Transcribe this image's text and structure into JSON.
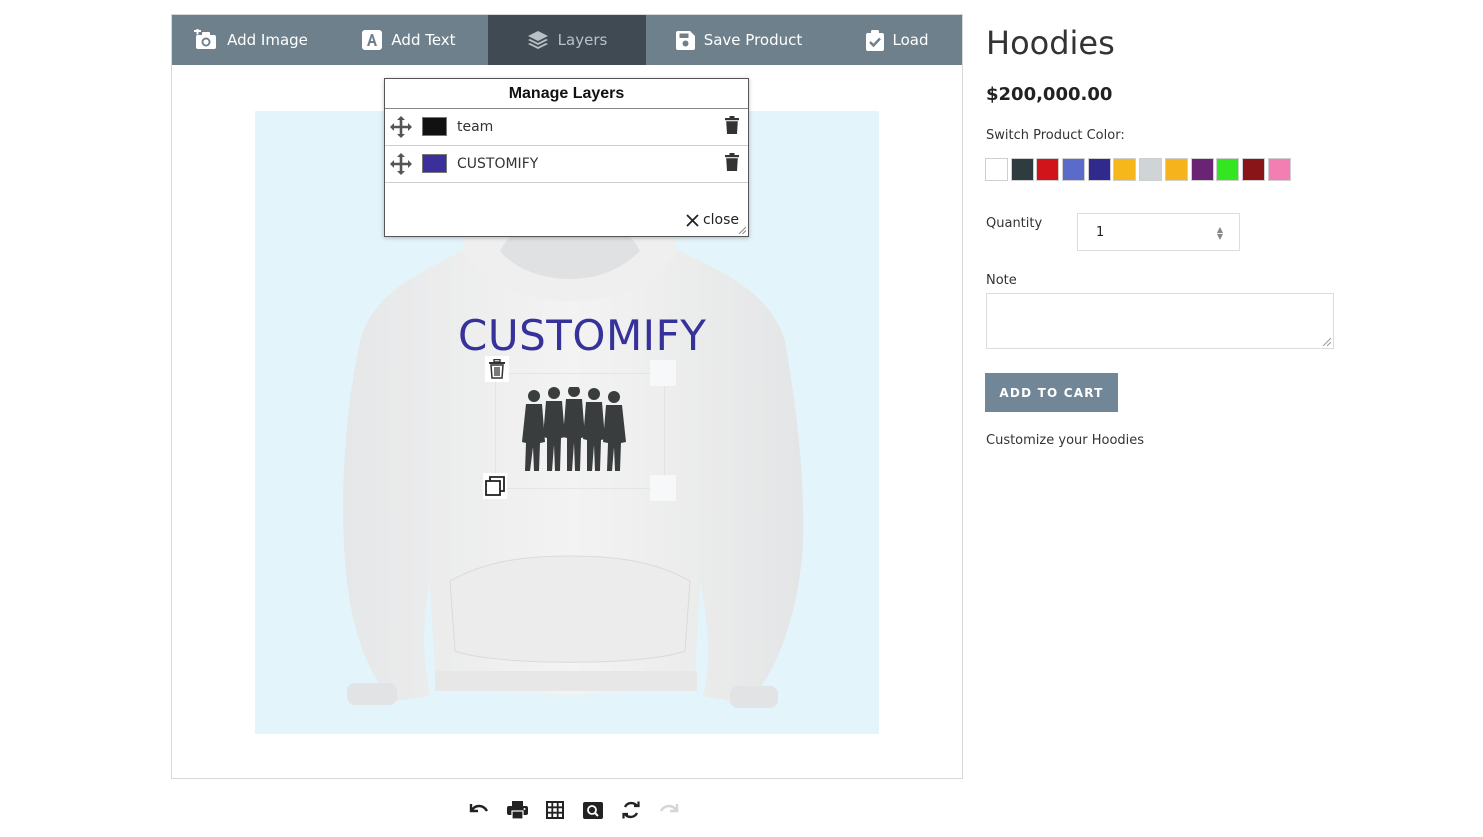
{
  "toolbar": {
    "add_image": "Add Image",
    "add_text": "Add Text",
    "layers": "Layers",
    "save_product": "Save Product",
    "load": "Load"
  },
  "canvas": {
    "design_text": "CUSTOMIFY"
  },
  "layers_modal": {
    "title": "Manage Layers",
    "layers": [
      {
        "name": "team",
        "color": "#111111"
      },
      {
        "name": "CUSTOMIFY",
        "color": "#3b2f9c"
      }
    ],
    "close_label": "close"
  },
  "bottom_tools": [
    "undo-icon",
    "print-icon",
    "grid-icon",
    "zoom-icon",
    "refresh-icon",
    "redo-icon"
  ],
  "product": {
    "title": "Hoodies",
    "price": "$200,000.00",
    "color_label": "Switch Product Color:",
    "colors": [
      "#ffffff",
      "#2e3b3f",
      "#d0141a",
      "#5a6bc9",
      "#302a8c",
      "#f5b71a",
      "#cfd4d6",
      "#f7b31b",
      "#6b2374",
      "#33e61f",
      "#8a1519",
      "#f27eb2"
    ],
    "quantity_label": "Quantity",
    "quantity_value": "1",
    "note_label": "Note",
    "note_value": "",
    "add_to_cart": "ADD TO CART",
    "customize_note": "Customize your Hoodies"
  },
  "colors": {
    "toolbar_bg": "#6e808c",
    "toolbar_active": "#3f4a52",
    "canvas_bg": "#e3f4fa",
    "button_bg": "#718696",
    "design_text": "#36329a"
  }
}
